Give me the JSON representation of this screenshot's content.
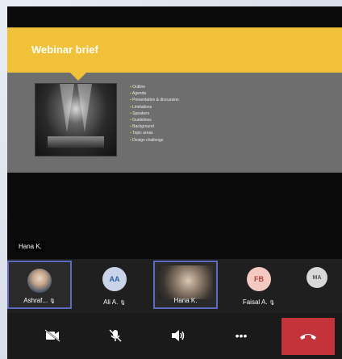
{
  "slide": {
    "title": "Webinar brief",
    "bullets": [
      "Outline",
      "Agenda",
      "Presentation & discussion",
      "Limitations",
      "Speakers",
      "Guidelines",
      "Background",
      "Topic areas",
      "Design challenge"
    ]
  },
  "video": {
    "name_label": "Hana K."
  },
  "participants": [
    {
      "name": "Ashraf...",
      "initials": "",
      "avatar": "photo",
      "selected": true,
      "muted": true,
      "avatar_bg": "#c9d4e8"
    },
    {
      "name": "Ali A.",
      "initials": "AA",
      "avatar": "initials",
      "selected": false,
      "muted": true,
      "avatar_bg": "#c9d4e8",
      "avatar_fg": "#2d5fa8"
    },
    {
      "name": "Hana K.",
      "initials": "",
      "avatar": "video",
      "selected": true,
      "muted": false
    },
    {
      "name": "Faisal A.",
      "initials": "FB",
      "avatar": "initials",
      "selected": false,
      "muted": true,
      "avatar_bg": "#f3c9c2",
      "avatar_fg": "#b2453a"
    },
    {
      "name": "",
      "initials": "MA",
      "avatar": "initials",
      "selected": false,
      "muted": false,
      "avatar_bg": "#d8d8d8",
      "avatar_fg": "#555555"
    }
  ],
  "controls": {
    "camera_icon": "camera-off-icon",
    "mic_icon": "mic-off-icon",
    "speaker_icon": "speaker-icon",
    "more_icon": "more-icon",
    "end_icon": "end-call-icon",
    "more_label": "•••"
  },
  "colors": {
    "accent": "#f2c13a",
    "end_call": "#c4323a",
    "selection": "#5c6bc0"
  }
}
